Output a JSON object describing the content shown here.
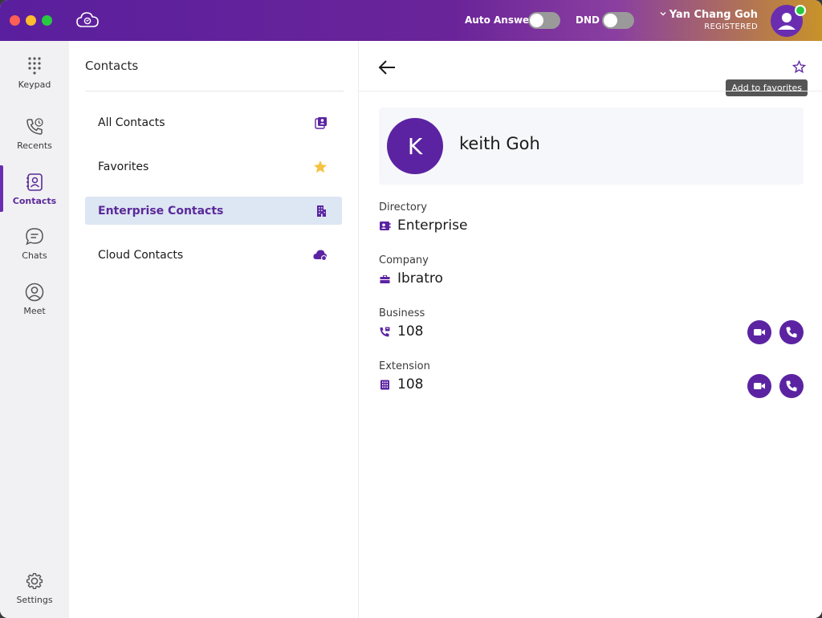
{
  "titlebar": {
    "auto_answer_label": "Auto Answer",
    "dnd_label": "DND",
    "user_name": "Yan Chang Goh",
    "user_status": "REGISTERED"
  },
  "nav": {
    "items": [
      {
        "label": "Keypad",
        "icon": "keypad-icon"
      },
      {
        "label": "Recents",
        "icon": "recents-icon"
      },
      {
        "label": "Contacts",
        "icon": "contacts-icon",
        "active": true
      },
      {
        "label": "Chats",
        "icon": "chats-icon"
      },
      {
        "label": "Meet",
        "icon": "meet-icon"
      }
    ],
    "settings_label": "Settings"
  },
  "contacts_panel": {
    "title": "Contacts",
    "items": [
      {
        "label": "All Contacts",
        "icon": "address-book-icon"
      },
      {
        "label": "Favorites",
        "icon": "star-icon"
      },
      {
        "label": "Enterprise Contacts",
        "icon": "building-icon",
        "selected": true
      },
      {
        "label": "Cloud Contacts",
        "icon": "cloud-contact-icon"
      }
    ]
  },
  "detail": {
    "tooltip": "Add to favorites",
    "avatar_initial": "K",
    "name": "keith Goh",
    "fields": [
      {
        "label": "Directory",
        "value": "Enterprise",
        "icon": "directory-icon"
      },
      {
        "label": "Company",
        "value": "Ibratro",
        "icon": "briefcase-icon"
      },
      {
        "label": "Business",
        "value": "108",
        "icon": "business-phone-icon"
      },
      {
        "label": "Extension",
        "value": "108",
        "icon": "extension-icon"
      }
    ]
  },
  "colors": {
    "accent": "#5b23a2",
    "favorites_star": "#f5c242",
    "selected_bg": "#dde6f3",
    "presence_online": "#27c840"
  }
}
